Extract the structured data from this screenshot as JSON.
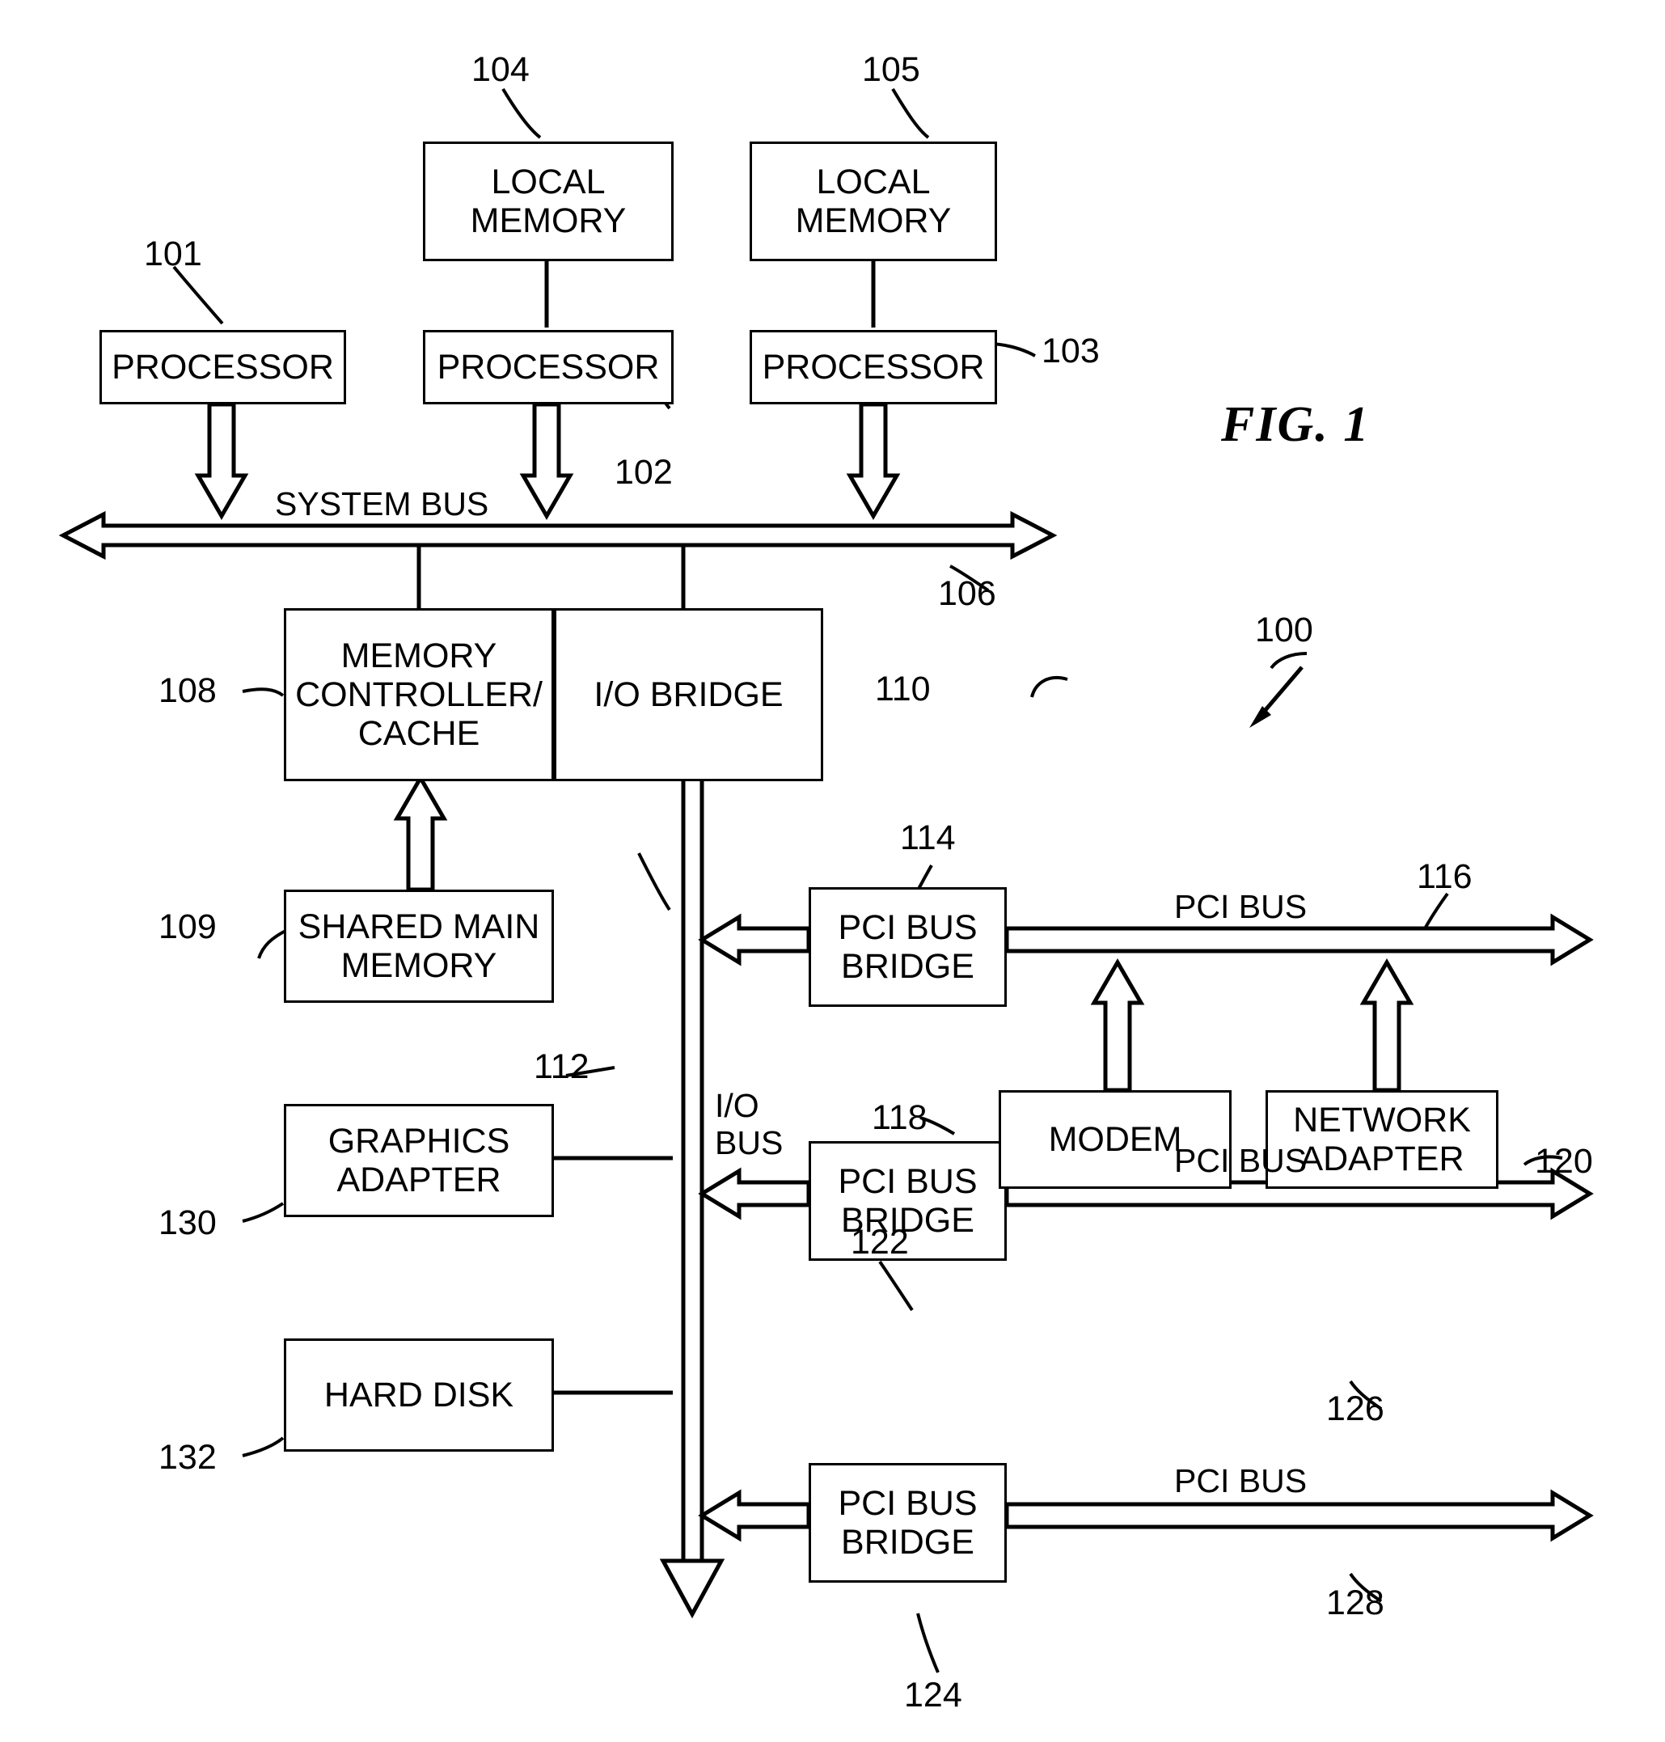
{
  "figure": {
    "label": "FIG. 1",
    "system_ref": "100"
  },
  "boxes": [
    {
      "id": "local_memory_1",
      "text": "LOCAL\nMEMORY",
      "ref": "104"
    },
    {
      "id": "local_memory_2",
      "text": "LOCAL\nMEMORY",
      "ref": "105"
    },
    {
      "id": "processor_1",
      "text": "PROCESSOR",
      "ref": "101"
    },
    {
      "id": "processor_2",
      "text": "PROCESSOR",
      "ref": "102"
    },
    {
      "id": "processor_3",
      "text": "PROCESSOR",
      "ref": "103"
    },
    {
      "id": "memory_controller_cache",
      "text": "MEMORY\nCONTROLLER/\nCACHE",
      "ref": "108"
    },
    {
      "id": "io_bridge",
      "text": "I/O BRIDGE",
      "ref": "110"
    },
    {
      "id": "shared_main_memory",
      "text": "SHARED MAIN\nMEMORY",
      "ref": "109"
    },
    {
      "id": "graphics_adapter",
      "text": "GRAPHICS\nADAPTER",
      "ref": "130"
    },
    {
      "id": "hard_disk",
      "text": "HARD DISK",
      "ref": "132"
    },
    {
      "id": "pci_bus_bridge_1",
      "text": "PCI BUS\nBRIDGE",
      "ref": "114"
    },
    {
      "id": "pci_bus_bridge_2",
      "text": "PCI BUS\nBRIDGE",
      "ref": "122"
    },
    {
      "id": "pci_bus_bridge_3",
      "text": "PCI BUS\nBRIDGE",
      "ref": "124"
    },
    {
      "id": "modem",
      "text": "MODEM",
      "ref": "118"
    },
    {
      "id": "network_adapter",
      "text": "NETWORK\nADAPTER",
      "ref": "120"
    }
  ],
  "buses": [
    {
      "id": "system_bus",
      "label": "SYSTEM BUS",
      "ref": "106"
    },
    {
      "id": "io_bus",
      "label": "I/O\nBUS",
      "ref": "112"
    },
    {
      "id": "pci_bus_1",
      "label": "PCI BUS",
      "ref": "116"
    },
    {
      "id": "pci_bus_2",
      "label": "PCI BUS",
      "ref": "126"
    },
    {
      "id": "pci_bus_3",
      "label": "PCI BUS",
      "ref": "128"
    }
  ],
  "text": {
    "local_memory_1": "LOCAL\nMEMORY",
    "local_memory_2": "LOCAL\nMEMORY",
    "processor_1": "PROCESSOR",
    "processor_2": "PROCESSOR",
    "processor_3": "PROCESSOR",
    "memory_controller_cache": "MEMORY\nCONTROLLER/\nCACHE",
    "io_bridge": "I/O BRIDGE",
    "shared_main_memory": "SHARED MAIN\nMEMORY",
    "graphics_adapter": "GRAPHICS\nADAPTER",
    "hard_disk": "HARD DISK",
    "pci_bus_bridge_1": "PCI BUS\nBRIDGE",
    "pci_bus_bridge_2": "PCI BUS\nBRIDGE",
    "pci_bus_bridge_3": "PCI BUS\nBRIDGE",
    "modem": "MODEM",
    "network_adapter": "NETWORK\nADAPTER",
    "system_bus": "SYSTEM BUS",
    "io_bus": "I/O\nBUS",
    "pci_bus_1": "PCI BUS",
    "pci_bus_2": "PCI BUS",
    "pci_bus_3": "PCI BUS"
  },
  "refs": {
    "r100": "100",
    "r101": "101",
    "r102": "102",
    "r103": "103",
    "r104": "104",
    "r105": "105",
    "r106": "106",
    "r108": "108",
    "r109": "109",
    "r110": "110",
    "r112": "112",
    "r114": "114",
    "r116": "116",
    "r118": "118",
    "r120": "120",
    "r122": "122",
    "r124": "124",
    "r126": "126",
    "r128": "128",
    "r130": "130",
    "r132": "132"
  }
}
